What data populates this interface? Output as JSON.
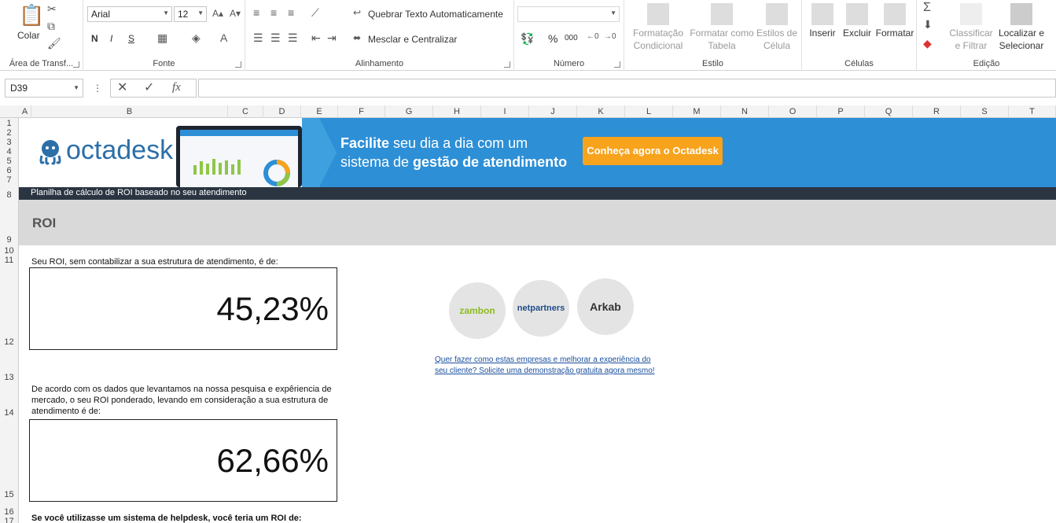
{
  "ribbon": {
    "clipboard": {
      "paste_label": "Colar",
      "group_label": "Área de Transf..."
    },
    "font": {
      "font_name": "Arial",
      "font_size": "12",
      "bold": "N",
      "italic": "I",
      "underline": "S",
      "group_label": "Fonte"
    },
    "alignment": {
      "wrap_text": "Quebrar Texto Automaticamente",
      "merge_center": "Mesclar e Centralizar",
      "group_label": "Alinhamento"
    },
    "number": {
      "percent": "%",
      "thousands": "000",
      "group_label": "Número"
    },
    "styles": {
      "conditional_1": "Formatação",
      "conditional_2": "Condicional",
      "table_1": "Formatar como",
      "table_2": "Tabela",
      "cell_1": "Estilos de",
      "cell_2": "Célula",
      "group_label": "Estilo"
    },
    "cells": {
      "insert": "Inserir",
      "delete": "Excluir",
      "format": "Formatar",
      "group_label": "Células"
    },
    "editing": {
      "sort_1": "Classificar",
      "sort_2": "e Filtrar",
      "find_1": "Localizar e",
      "find_2": "Selecionar",
      "group_label": "Edição"
    }
  },
  "formula_bar": {
    "name_box": "D39",
    "fx": "fx",
    "formula": ""
  },
  "columns": [
    "A",
    "B",
    "C",
    "D",
    "E",
    "F",
    "G",
    "H",
    "I",
    "J",
    "K",
    "L",
    "M",
    "N",
    "O",
    "P",
    "Q",
    "R",
    "S",
    "T"
  ],
  "rows": [
    "1",
    "2",
    "3",
    "4",
    "5",
    "6",
    "7",
    "8",
    "9",
    "10",
    "11",
    "12",
    "13",
    "14",
    "15",
    "16",
    "17"
  ],
  "banner": {
    "logo": "octadesk",
    "headline_bold": "Facilite",
    "headline_rest": " seu dia a dia com um",
    "subline_pre": "sistema de ",
    "subline_bold": "gestão de atendimento",
    "cta": "Conheça agora o Octadesk"
  },
  "subtitle_bar": "Planilha de cálculo de ROI baseado no seu atendimento",
  "section_title": "ROI",
  "content": {
    "roi_label": "Seu ROI, sem contabilizar a sua estrutura de atendimento, é de:",
    "roi_value": "45,23%",
    "weighted_label_1": "De acordo com os dados que levantamos na nossa pesquisa e expêriencia de",
    "weighted_label_2": "mercado, o seu ROI ponderado, levando em consideração a sua estrutura de",
    "weighted_label_3": "atendimento é de:",
    "weighted_value": "62,66%",
    "helpdesk_label": "Se você utilizasse um sistema de helpdesk, você teria um ROI de:"
  },
  "partners": [
    "zambon",
    "netpartners",
    "Arkab"
  ],
  "cta_link_1": "Quer fazer como estas empresas e melhorar a experiência do",
  "cta_link_2": "seu cliente? Solicite uma demonstração gratuita agora mesmo!",
  "colors": {
    "banner_blue": "#2d8fd6",
    "cta_orange": "#f7a31c",
    "dark_bar": "#2b3542",
    "roi_bar": "#d9d9d9"
  }
}
